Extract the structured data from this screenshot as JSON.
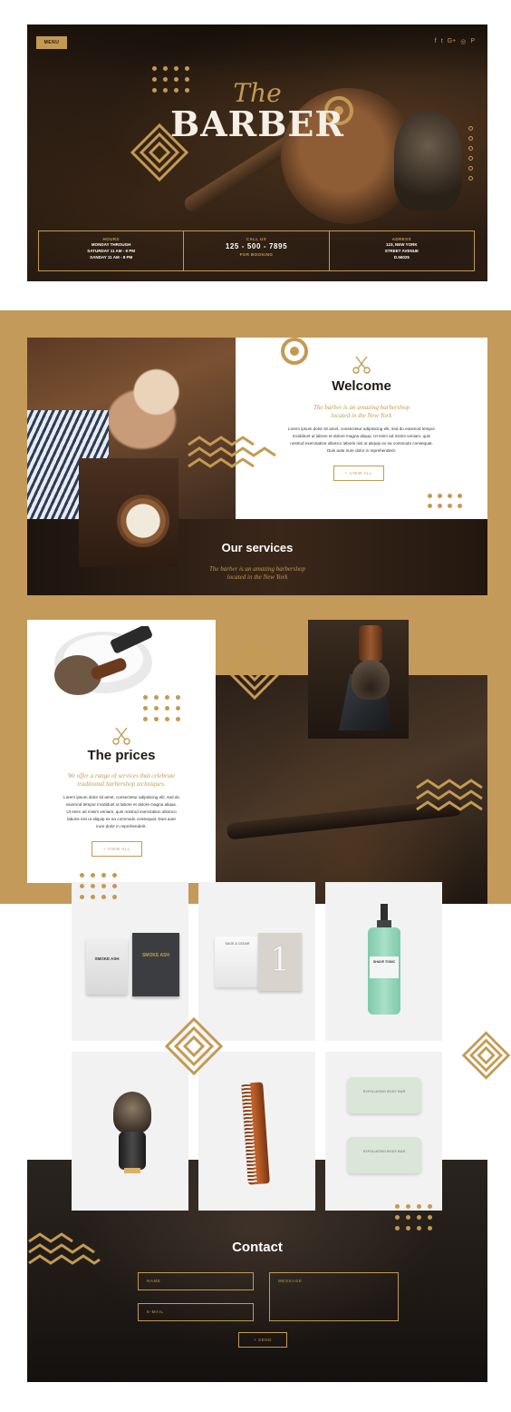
{
  "colors": {
    "gold": "#c49a53",
    "dark": "#1f1a16",
    "tan": "#c49a5a"
  },
  "hero": {
    "menu_label": "MENU",
    "social_icons": [
      "facebook-icon",
      "twitter-icon",
      "google-plus-icon",
      "instagram-icon",
      "pinterest-icon"
    ],
    "social_glyphs": [
      "f",
      "t",
      "G+",
      "◎",
      "P"
    ],
    "logo_the": "The",
    "logo_barber": "BARBER",
    "info": {
      "hours": {
        "caption": "HOURS",
        "lines": [
          "MONDAY THROUGH",
          "SATURDAY 11 AM - 9 PM",
          "SANDAY 11 AM - 8 PM"
        ]
      },
      "call": {
        "caption": "CALL US",
        "phone": "125 - 500 - 7895",
        "sub": "FOR BOOKING"
      },
      "address": {
        "caption": "ADRESS",
        "lines": [
          "123, NEW YORK",
          "STREET AVENUE",
          "D.56025"
        ]
      }
    }
  },
  "welcome": {
    "title": "Welcome",
    "tagline_1": "The barber is an amazing barbershop",
    "tagline_2": "located in the New York",
    "body_1": "Lorem ipsum dolor sit amet, consectetur adipisicing elit, sed do eiusmod tempor",
    "body_2": "incididunt ut labore et dolore magna aliqua. Ut enim ad minim veniam, quis",
    "body_3": "nostrud exercitation ullamco laboris nisi ut aliquip ex ea commodo consequat.",
    "body_4": "Duis aute irure dolor in reprehenderit.",
    "button": "+ VIEW ALL"
  },
  "services": {
    "title": "Our services",
    "tagline_1": "The barber is an amazing barbershop",
    "tagline_2": "located in the New York"
  },
  "prices": {
    "title": "The prices",
    "tagline_1": "We offer a range of services that celebrate",
    "tagline_2": "traditional barbershop techniques.",
    "body_1": "Lorem ipsum dolor sit amet, consectetur adipisicing elit, sed do",
    "body_2": "eiusmod tempor incididunt ut labore et dolore magna aliqua.",
    "body_3": "Ut enim ad minim veniam, quis nostrud exercitation ullamco",
    "body_4": "laboris nisi ut aliquip ex ea commodo consequat. Duis aute",
    "body_5": "irure dolor in reprehenderit.",
    "button": "+ VIEW ALL"
  },
  "products": {
    "candle_label": "SMOKE ASH",
    "box_label": "SMOKE ASH",
    "candle2_label": "SAGE & CEDAR",
    "box2_number": "1",
    "spray_label": "SHAVE TONIC",
    "soap_label": "EXFOLIATING BODY BAR"
  },
  "contact": {
    "title": "Contact",
    "name_placeholder": "NAME",
    "email_placeholder": "E-MAIL",
    "message_placeholder": "MESSAGE",
    "send_button": "+ SEND"
  }
}
